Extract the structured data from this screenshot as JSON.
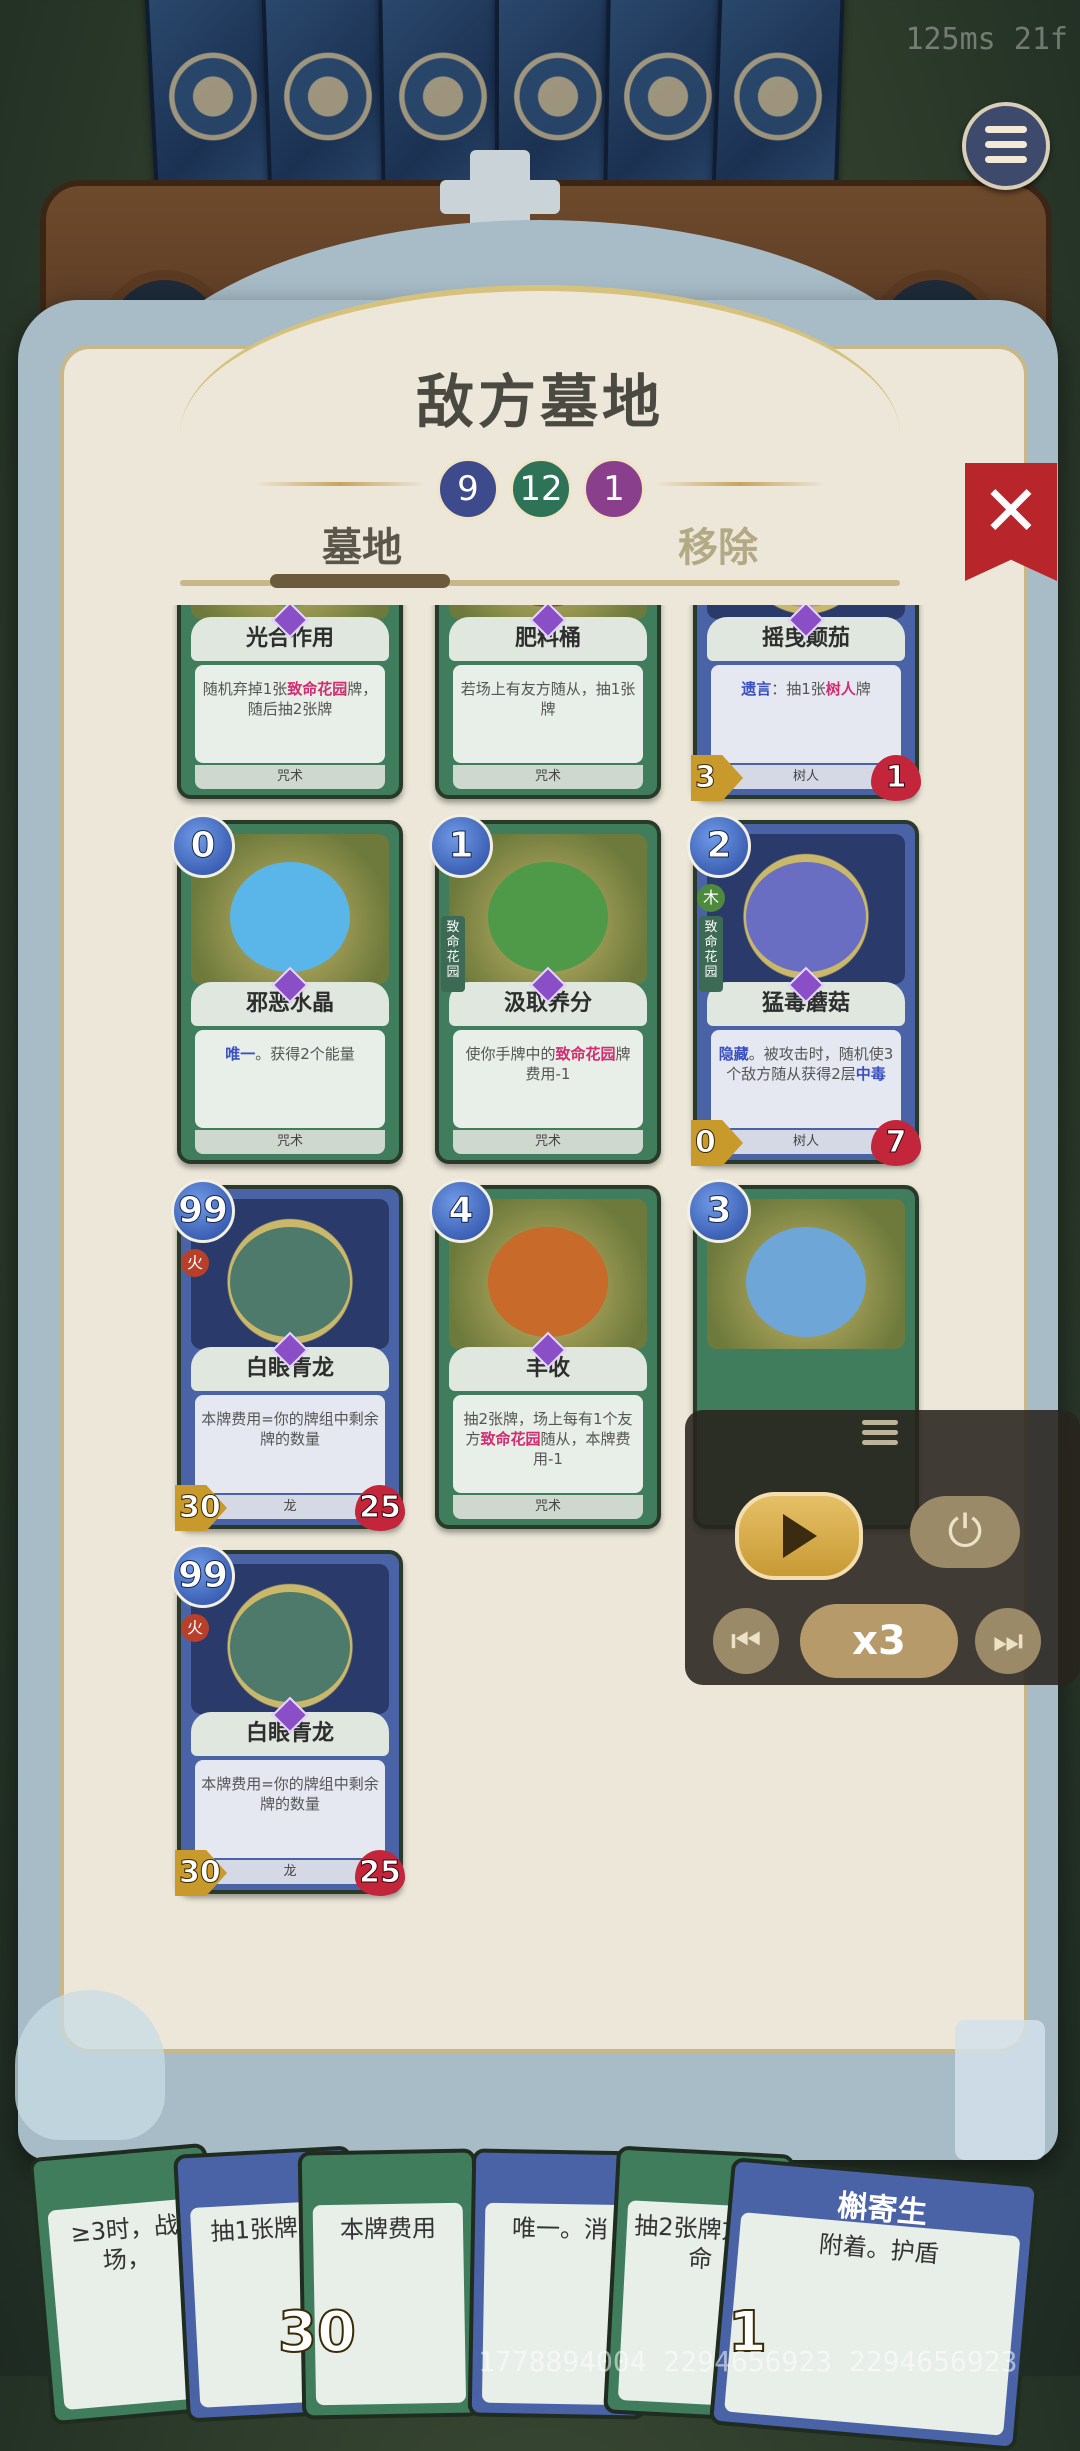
{
  "perf_text": "125ms 21f",
  "panel": {
    "title": "敌方墓地",
    "counts": [
      {
        "value": "9",
        "color": "#3d4a8c"
      },
      {
        "value": "12",
        "color": "#2e7258"
      },
      {
        "value": "1",
        "color": "#8a3f8c"
      }
    ],
    "tabs": [
      {
        "label": "墓地",
        "active": true
      },
      {
        "label": "移除",
        "active": false
      }
    ]
  },
  "cards": [
    {
      "name": "光合作用",
      "text_pre": "随机弃掉1张",
      "text_hl": "致命花园",
      "text_post": "牌，随后抽2张牌",
      "type": "咒术",
      "color": "green"
    },
    {
      "name": "肥料桶",
      "text_pre": "若场上有友方",
      "text_hl": "",
      "text_post": "随从，抽1张牌",
      "type": "咒术",
      "color": "green"
    },
    {
      "name": "摇曳颠茄",
      "text_kw": "遗言",
      "text_pre": "：抽1张",
      "text_hl": "树人",
      "text_post": "牌",
      "type": "树人",
      "atk": "3",
      "hp": "1",
      "faction": "木",
      "color": "blue"
    },
    {
      "name": "邪恶水晶",
      "text_kw": "唯一",
      "text_pre": "。获得2个能量",
      "type": "咒术",
      "cost": "0",
      "color": "green"
    },
    {
      "name": "汲取养分",
      "text_pre": "使你手牌中的",
      "text_hl": "致命花园",
      "text_post": "牌费用-1",
      "type": "咒术",
      "cost": "1",
      "tag": "致命花园",
      "color": "green"
    },
    {
      "name": "猛毒蘑菇",
      "text_kw": "隐藏",
      "text_pre": "。被攻击时，随机使3个敌方随从获得2层",
      "text_kw2": "中毒",
      "type": "树人",
      "cost": "2",
      "atk": "0",
      "hp": "7",
      "faction": "木",
      "tag": "致命花园",
      "color": "blue"
    },
    {
      "name": "白眼青龙",
      "text_pre": "本牌费用=你的牌组中剩余牌的数量",
      "type": "龙",
      "cost": "99",
      "atk": "30",
      "hp": "25",
      "faction": "火",
      "color": "blue"
    },
    {
      "name": "丰收",
      "text_pre": "抽2张牌，场上每有1个友方",
      "text_hl": "致命花园",
      "text_post": "随从，本牌费用-1",
      "type": "咒术",
      "cost": "4",
      "color": "green"
    },
    {
      "name": "",
      "text_pre": "",
      "type": "",
      "cost": "3",
      "color": "green"
    },
    {
      "name": "白眼青龙",
      "text_pre": "本牌费用=你的牌组中剩余牌的数量",
      "type": "龙",
      "cost": "99",
      "atk": "30",
      "hp": "25",
      "faction": "火",
      "color": "blue"
    }
  ],
  "controls": {
    "speed_label": "x3",
    "power_icon": "⏻",
    "prev_icon": "⏮",
    "next_icon": "⏭"
  },
  "hand": [
    {
      "text": "≥3时，战场，"
    },
    {
      "text": "抽1张牌，"
    },
    {
      "text": "本牌费用"
    },
    {
      "text": "唯一。消"
    },
    {
      "text": "抽2张牌方致命"
    },
    {
      "text": "附着。护盾",
      "title": "槲寄生"
    }
  ],
  "hand_numbers": {
    "a": "30",
    "b": "1"
  },
  "footer_numbers": "1778894004  2294656923 2294656923",
  "close_label": "✕",
  "tomb_icon": "✝"
}
